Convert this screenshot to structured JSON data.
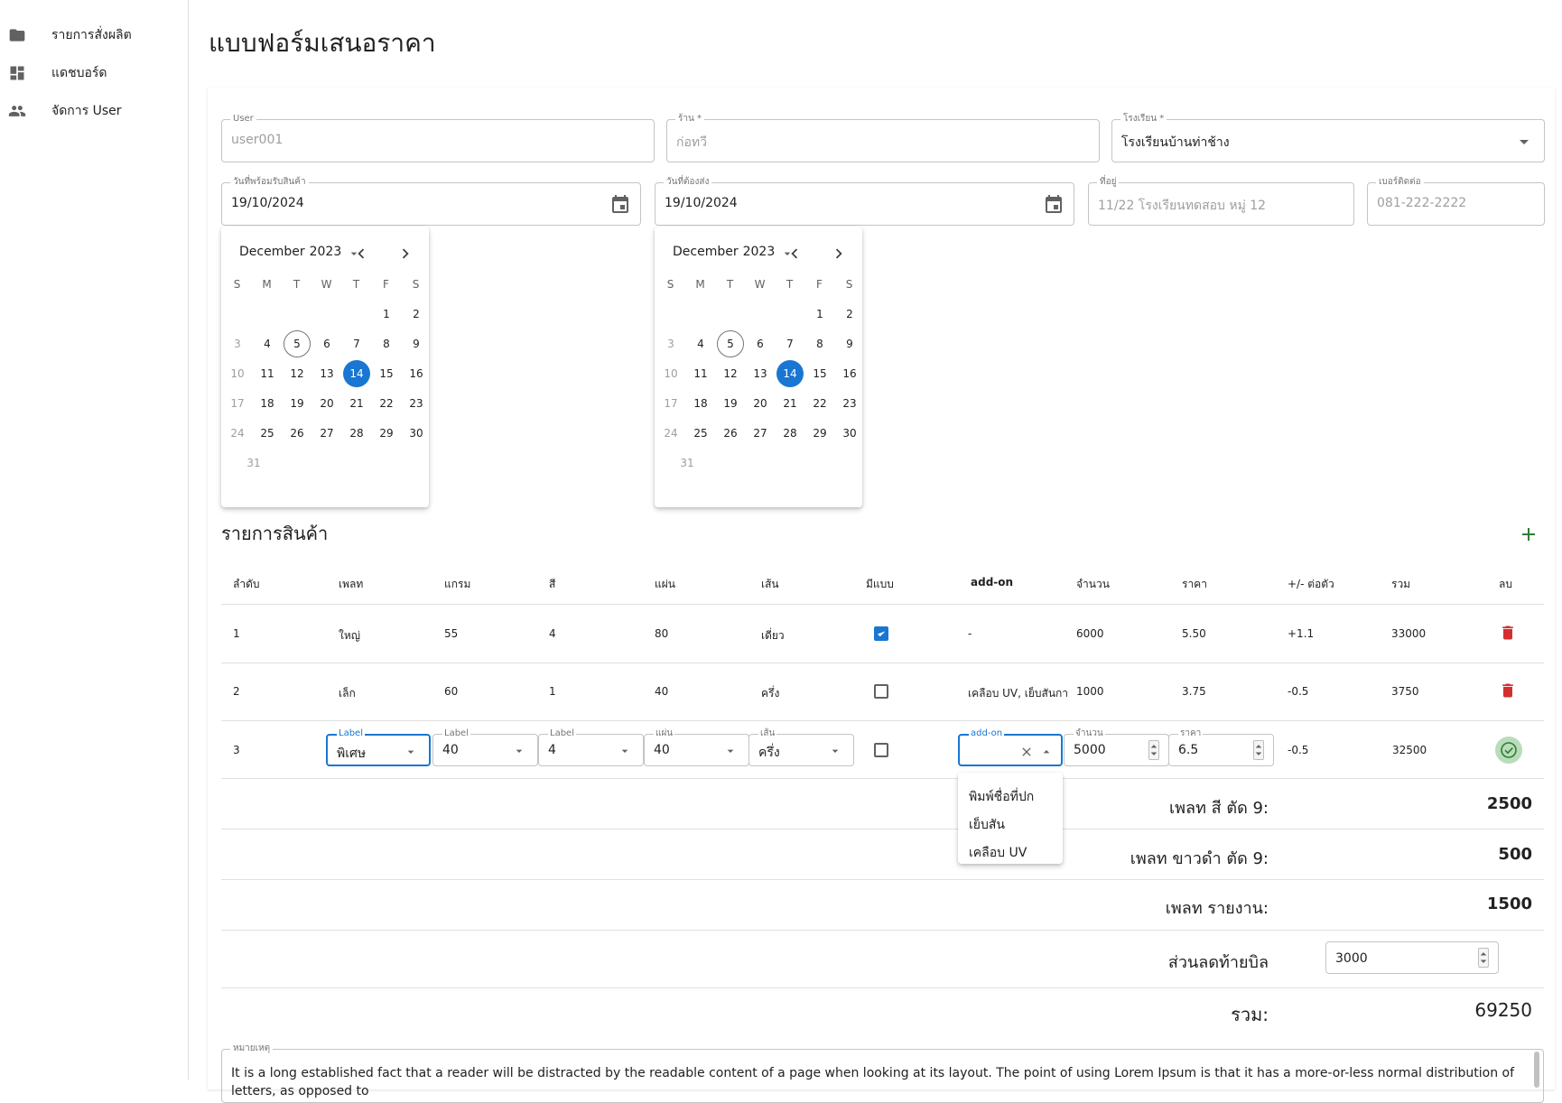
{
  "sidebar": {
    "items": [
      {
        "label": "รายการสั่งผลิต",
        "icon": "folder-icon"
      },
      {
        "label": "แดชบอร์ด",
        "icon": "dashboard-icon"
      },
      {
        "label": "จัดการ User",
        "icon": "people-icon"
      }
    ]
  },
  "page": {
    "title": "แบบฟอร์มเสนอราคา"
  },
  "form": {
    "user": {
      "label": "User",
      "value": "user001"
    },
    "shop": {
      "label": "ร้าน *",
      "value": "ก่อทวี"
    },
    "school": {
      "label": "โรงเรียน *",
      "value": "โรงเรียนบ้านท่าช้าง"
    },
    "ready_date": {
      "label": "วันที่พร้อมรับสินค้า",
      "value": "19/10/2024"
    },
    "delivery_date": {
      "label": "วันที่ต้องส่ง",
      "value": "19/10/2024"
    },
    "address": {
      "label": "ที่อยู่",
      "value": "11/22 โรงเรียนทดสอบ หมู่ 12"
    },
    "phone": {
      "label": "เบอร์ติดต่อ",
      "value": "081-222-2222"
    }
  },
  "calendar": {
    "month": "December",
    "year": "2023",
    "weekdays": [
      "S",
      "M",
      "T",
      "W",
      "T",
      "F",
      "S"
    ],
    "today": "5",
    "selected": "14"
  },
  "items_section": {
    "title": "รายการสินค้า",
    "columns": [
      "ลำดับ",
      "เพลท",
      "แกรม",
      "สี",
      "แผ่น",
      "เส้น",
      "มีแบบ",
      "add-on",
      "จำนวน",
      "ราคา",
      "+/- ต่อตัว",
      "รวม",
      "ลบ"
    ],
    "rows": [
      {
        "no": "1",
        "plate": "ใหญ่",
        "gram": "55",
        "color": "4",
        "sheets": "80",
        "line": "เดี่ยว",
        "has_design": true,
        "addon": "-",
        "qty": "6000",
        "price": "5.50",
        "adjust": "+1.1",
        "total": "33000"
      },
      {
        "no": "2",
        "plate": "เล็ก",
        "gram": "60",
        "color": "1",
        "sheets": "40",
        "line": "ครึ่ง",
        "has_design": false,
        "addon": "เคลือบ UV, เย็บสันกาว",
        "qty": "1000",
        "price": "3.75",
        "adjust": "-0.5",
        "total": "3750"
      }
    ],
    "edit_row": {
      "no": "3",
      "plate": {
        "label": "Label",
        "value": "พิเศษ"
      },
      "gram": {
        "label": "Label",
        "value": "40"
      },
      "color": {
        "label": "Label",
        "value": "4"
      },
      "sheets": {
        "label": "แผ่น",
        "value": "40"
      },
      "line": {
        "label": "เส้น",
        "value": "ครึ่ง"
      },
      "has_design": false,
      "addon": {
        "label": "add-on",
        "value": ""
      },
      "qty": {
        "label": "จำนวน",
        "value": "5000"
      },
      "price": {
        "label": "ราคา",
        "value": "6.5"
      },
      "adjust": "-0.5",
      "total": "32500"
    },
    "addon_options": [
      "พิมพ์ชื่อที่ปก",
      "เย็บสัน",
      "เคลือบ UV"
    ]
  },
  "summary": {
    "color_plate": {
      "label": "เพลท สี ตัด 9:",
      "value": "2500"
    },
    "bw_plate": {
      "label": "เพลท ขาวดำ ตัด 9:",
      "value": "500"
    },
    "report_plate": {
      "label": "เพลท รายงาน:",
      "value": "1500"
    },
    "discount": {
      "label": "ส่วนลดท้ายบิล",
      "value": "3000"
    },
    "total": {
      "label": "รวม:",
      "value": "69250"
    }
  },
  "note": {
    "label": "หมายเหตุ",
    "value": "It is a long established fact that a reader will be distracted by the readable content of a page when looking at its layout. The point of using Lorem Ipsum is that it has a more-or-less normal distribution of letters, as opposed to"
  },
  "colors": {
    "accent": "#1976d2",
    "delete": "#d32f2f",
    "confirm": "#2e7d32"
  }
}
